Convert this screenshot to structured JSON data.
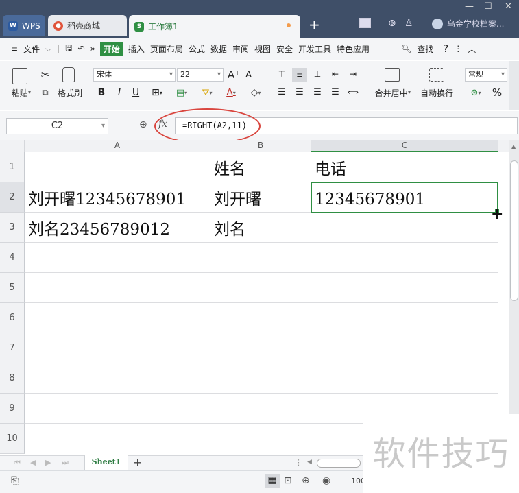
{
  "titlebar": {
    "tabs": [
      {
        "label": "WPS"
      },
      {
        "label": "稻壳商城"
      },
      {
        "label": "工作簿1"
      }
    ],
    "new_tab": "+",
    "page_badge": "1",
    "user_name": "乌金学校档案..."
  },
  "menu": {
    "file": "文件",
    "items": [
      "开始",
      "插入",
      "页面布局",
      "公式",
      "数据",
      "审阅",
      "视图",
      "安全",
      "开发工具",
      "特色应用"
    ],
    "search": "查找",
    "help": "?"
  },
  "ribbon": {
    "paste": "粘贴",
    "format_painter": "格式刷",
    "font_name": "宋体",
    "font_size": "22",
    "merge_center": "合并居中",
    "wrap_text": "自动换行",
    "number_format": "常规",
    "percent": "%"
  },
  "formula_bar": {
    "name_box": "C2",
    "fx": "fx",
    "formula": "=RIGHT(A2,11)"
  },
  "sheet": {
    "columns": [
      "A",
      "B",
      "C"
    ],
    "rows": [
      "1",
      "2",
      "3",
      "4",
      "5",
      "6",
      "7",
      "8",
      "9",
      "10"
    ],
    "cells": {
      "B1": "姓名",
      "C1": "电话",
      "A2": "刘开曙12345678901",
      "B2": "刘开曙",
      "C2": "12345678901",
      "A3": "刘名23456789012",
      "B3": "刘名"
    },
    "selected_cell": "C2"
  },
  "sheet_tabs": [
    {
      "label": "Sheet1"
    }
  ],
  "add_sheet": "+",
  "status": {
    "zoom": "100"
  },
  "watermark": "软件技巧",
  "colors": {
    "accent": "#2f8f43",
    "title_bg": "#3f4f68",
    "annotation": "#d9463f"
  }
}
